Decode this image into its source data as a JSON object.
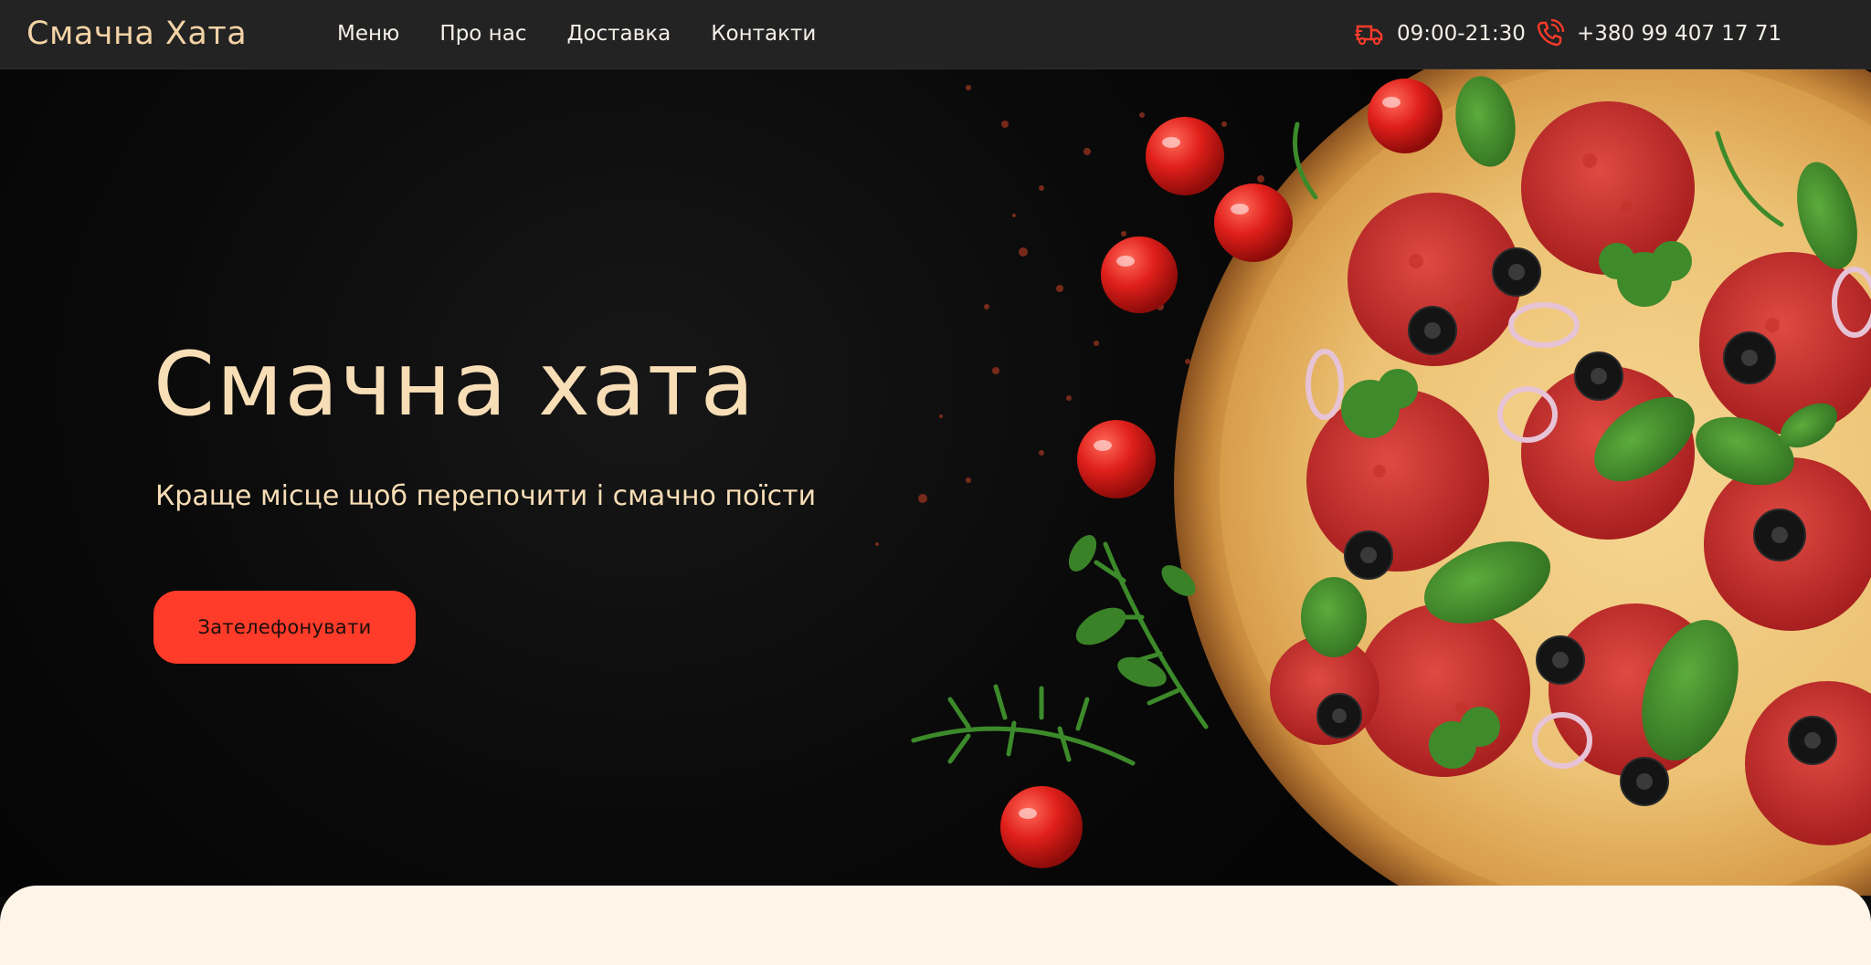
{
  "header": {
    "logo": "Смачна Хата",
    "nav": [
      {
        "label": "Меню"
      },
      {
        "label": "Про нас"
      },
      {
        "label": "Доставка"
      },
      {
        "label": "Контакти"
      }
    ],
    "hours": "09:00-21:30",
    "phone": "+380 99 407 17 71",
    "icons": {
      "hours": "delivery-clock-icon",
      "phone": "phone-call-icon"
    }
  },
  "hero": {
    "title": "Смачна хата",
    "subtitle": "Краще місце щоб перепочити і смачно поїсти",
    "call_button": "Зателефонувати"
  },
  "colors": {
    "header_bg": "#232323",
    "accent": "#ff3b2a",
    "title": "#f8deb6",
    "next_section_bg": "#fff4e8"
  }
}
